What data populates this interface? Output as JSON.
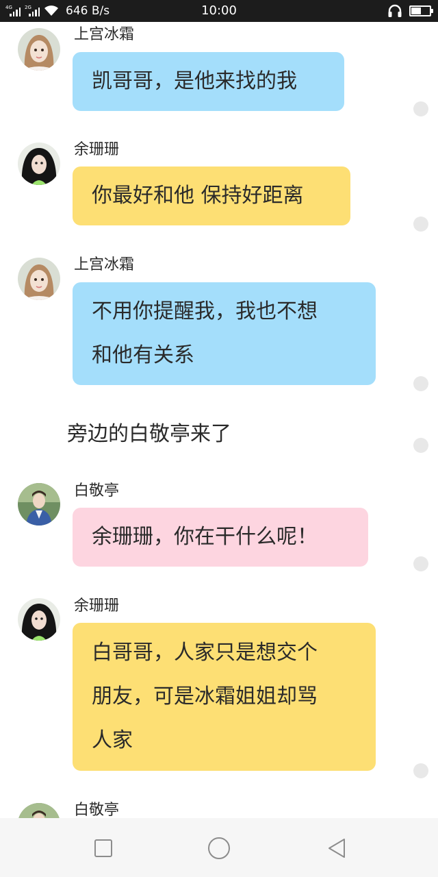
{
  "status_bar": {
    "network_1": "4G",
    "network_2": "2G",
    "speed": "646 B/s",
    "time": "10:00",
    "battery_level": 0.55
  },
  "messages": [
    {
      "type": "message",
      "sender": "上宫冰霜",
      "text": "凯哥哥，是他来找的我",
      "color": "#a4defb",
      "avatar": "avatar-shangguan-bingshuang"
    },
    {
      "type": "message",
      "sender": "余珊珊",
      "text": "你最好和他 保持好距离",
      "color": "#fddf74",
      "avatar": "avatar-yu-shanshan"
    },
    {
      "type": "message",
      "sender": "上宫冰霜",
      "text": "不用你提醒我，我也不想\n和他有关系",
      "color": "#a4defb",
      "avatar": "avatar-shangguan-bingshuang"
    },
    {
      "type": "narration",
      "text": "旁边的白敬亭来了"
    },
    {
      "type": "message",
      "sender": "白敬亭",
      "text": "余珊珊，你在干什么呢！",
      "color": "#fdd5e0",
      "avatar": "avatar-bai-jingting"
    },
    {
      "type": "message",
      "sender": "余珊珊",
      "text": "白哥哥，人家只是想交个\n朋友，可是冰霜姐姐却骂\n人家",
      "color": "#fddf74",
      "avatar": "avatar-yu-shanshan"
    },
    {
      "type": "message",
      "sender": "白敬亭",
      "text": "",
      "color": "#a4defb",
      "avatar": "avatar-bai-jingting"
    }
  ],
  "nav_bar": {
    "recent_icon": "square-icon",
    "home_icon": "circle-icon",
    "back_icon": "triangle-back-icon"
  }
}
